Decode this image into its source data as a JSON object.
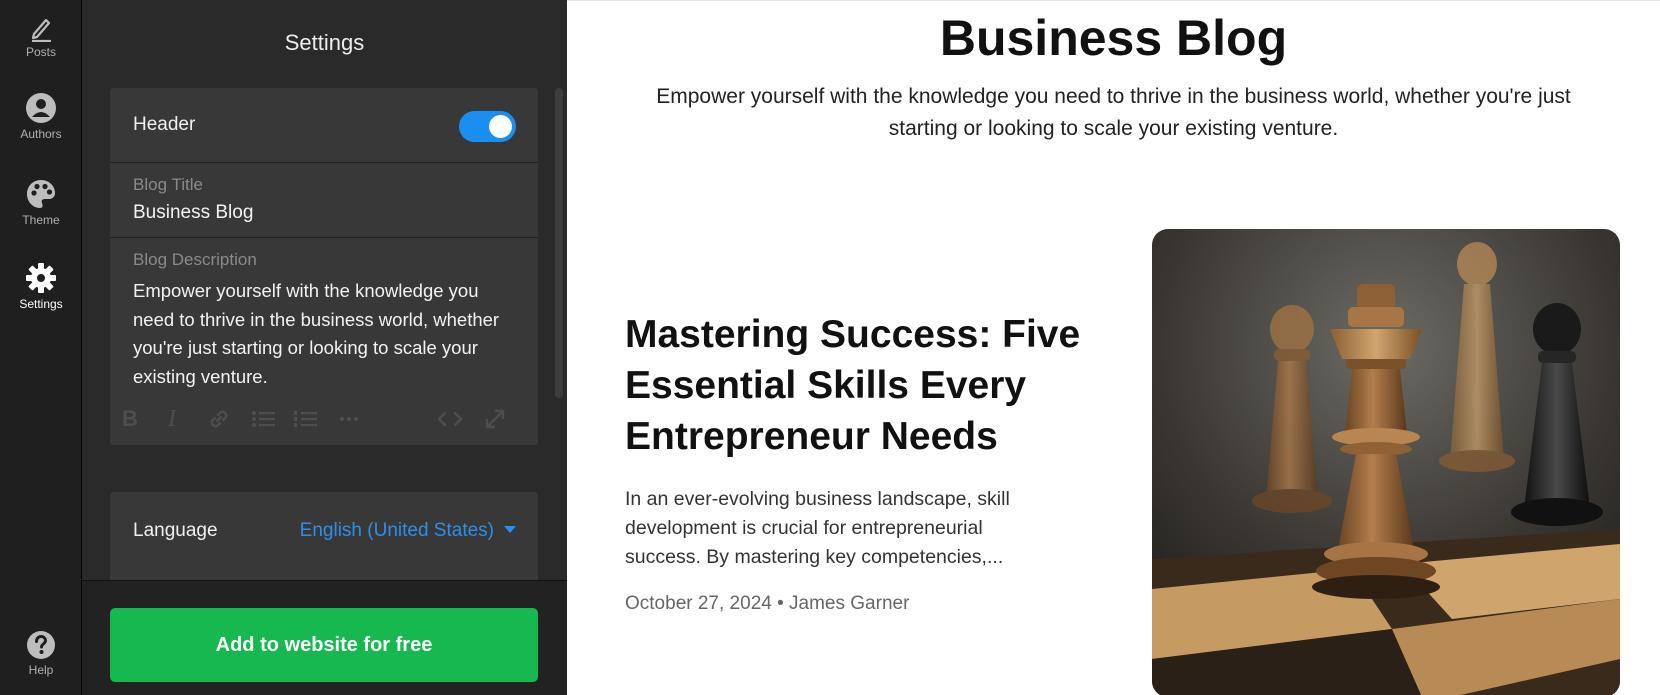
{
  "sidebar": {
    "items": [
      {
        "label": "Posts",
        "icon": "pen-icon"
      },
      {
        "label": "Authors",
        "icon": "user-circle-icon"
      },
      {
        "label": "Theme",
        "icon": "palette-icon"
      },
      {
        "label": "Settings",
        "icon": "gear-icon",
        "active": true
      },
      {
        "label": "Help",
        "icon": "help-icon"
      }
    ]
  },
  "settings": {
    "title": "Settings",
    "header": {
      "label": "Header",
      "enabled": true,
      "blog_title_label": "Blog Title",
      "blog_title_value": "Business Blog",
      "blog_description_label": "Blog Description",
      "blog_description_value": "Empower yourself with the knowledge you need to thrive in the business world, whether you're just starting or looking to scale your existing venture.",
      "toolbar": [
        "bold-icon",
        "italic-icon",
        "link-icon",
        "bulleted-list-icon",
        "numbered-list-icon",
        "more-icon",
        "code-icon",
        "expand-icon"
      ]
    },
    "language": {
      "label": "Language",
      "value": "English (United States)"
    },
    "cta_label": "Add to website for free"
  },
  "preview": {
    "blog_title": "Business Blog",
    "blog_description": "Empower yourself with the knowledge you need to thrive in the business world, whether you're just starting or looking to scale your existing venture.",
    "post": {
      "title": "Mastering Success: Five Essential Skills Every Entrepreneur Needs",
      "excerpt": "In an ever-evolving business landscape, skill development is crucial for entrepreneurial success. By mastering key competencies,...",
      "meta": "October 27, 2024 • James Garner",
      "image": "chess-king-photo"
    }
  },
  "colors": {
    "accent": "#1b8ef2",
    "link": "#2f8ee8",
    "cta": "#16b84f",
    "rail": "#1f1f1f",
    "panel": "#2a2a2a",
    "card": "#383838"
  }
}
